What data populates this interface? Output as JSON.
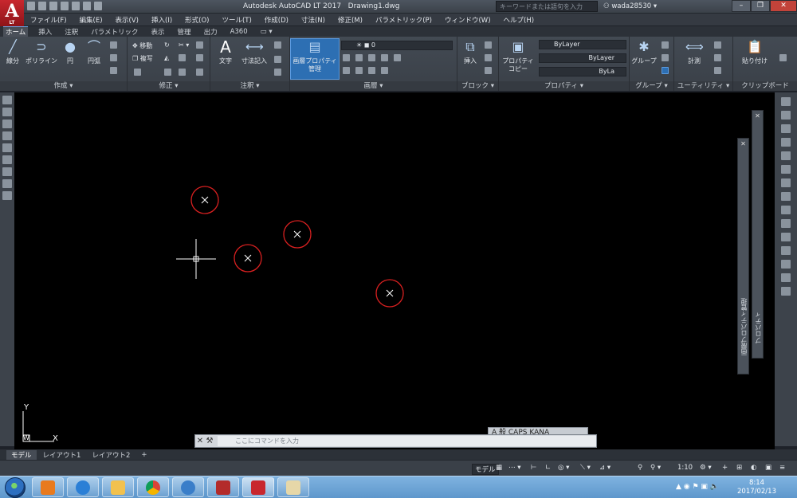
{
  "app": {
    "title": "Autodesk AutoCAD LT 2017",
    "document": "Drawing1.dwg",
    "logo_letter": "A",
    "logo_sub": "LT",
    "search_placeholder": "キーワードまたは語句を入力",
    "username": "wada28530"
  },
  "menu": [
    "ファイル(F)",
    "編集(E)",
    "表示(V)",
    "挿入(I)",
    "形式(O)",
    "ツール(T)",
    "作成(D)",
    "寸法(N)",
    "修正(M)",
    "パラメトリック(P)",
    "ウィンドウ(W)",
    "ヘルプ(H)"
  ],
  "ribbon_tabs": [
    "ホーム",
    "挿入",
    "注釈",
    "パラメトリック",
    "表示",
    "管理",
    "出力",
    "A360"
  ],
  "ribbon": {
    "draw": {
      "title": "作成 ▾",
      "line": "線分",
      "polyline": "ポリライン",
      "circle": "円",
      "arc": "円弧"
    },
    "modify": {
      "title": "修正 ▾",
      "move": "移動",
      "copy": "複写"
    },
    "annotation": {
      "title": "注釈 ▾",
      "text": "文字",
      "dimension": "寸法記入"
    },
    "layers": {
      "title": "画層 ▾",
      "layer_props_1": "画層プロパティ",
      "layer_props_2": "管理",
      "current_layer": "0"
    },
    "block": {
      "title": "ブロック ▾",
      "insert": "挿入"
    },
    "properties": {
      "title": "プロパティ ▾",
      "match_1": "プロパティ",
      "match_2": "コピー",
      "color": "ByLayer",
      "linetype": "ByLayer",
      "lineweight": "ByLa"
    },
    "groups": {
      "title": "グループ ▾",
      "group": "グループ"
    },
    "utilities": {
      "title": "ユーティリティ ▾",
      "measure": "計測"
    },
    "clipboard": {
      "title": "クリップボード",
      "paste": "貼り付け"
    }
  },
  "palettes": {
    "layer_palette": "画層プロパティ管理",
    "properties_palette": "プロパティ"
  },
  "ucs": {
    "y": "Y",
    "w": "W",
    "x": "X"
  },
  "command": {
    "placeholder": "ここにコマンドを入力"
  },
  "ime": {
    "text": "A 般 CAPS KANA"
  },
  "layout_tabs": [
    "モデル",
    "レイアウト1",
    "レイアウト2",
    "+"
  ],
  "status": {
    "model": "モデル",
    "scale": "1:10"
  },
  "taskbar": {
    "time": "8:14",
    "date": "2017/02/13"
  },
  "colors": {
    "canvas": "#000000",
    "marker": "#d92020",
    "crosshair": "#ffffff",
    "brand": "#c8272e"
  }
}
